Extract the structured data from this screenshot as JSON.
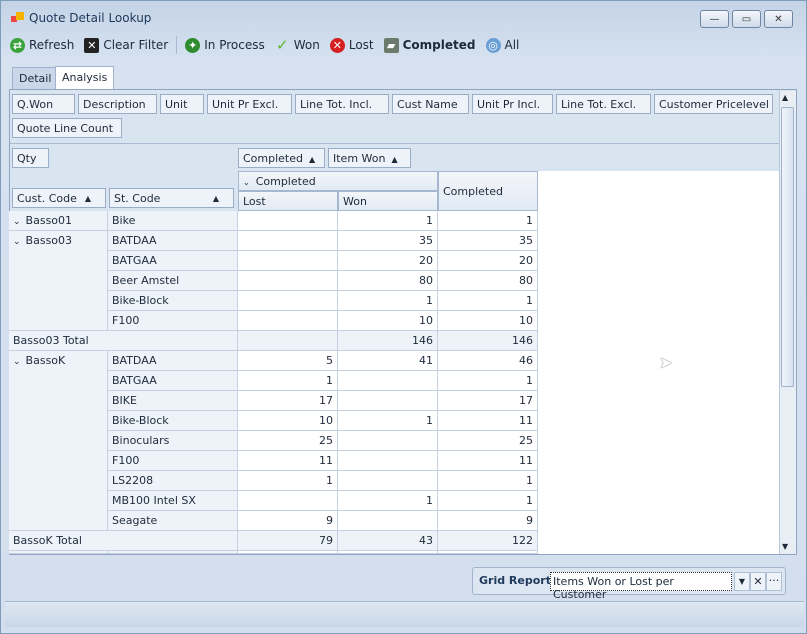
{
  "window": {
    "title": "Quote Detail Lookup",
    "buttons": [
      "minimize",
      "maximize",
      "close"
    ]
  },
  "toolbar": [
    {
      "label": "Refresh",
      "icon": "refresh-icon",
      "color": "#3aa23a"
    },
    {
      "label": "Clear Filter",
      "icon": "clear-filter-icon",
      "color": "#222222"
    },
    {
      "label": "In Process",
      "icon": "running-man-icon",
      "color": "#2e8b2e"
    },
    {
      "label": "Won",
      "icon": "checkmark-icon",
      "color": "#5cb82e"
    },
    {
      "label": "Lost",
      "icon": "x-circle-icon",
      "color": "#d42020"
    },
    {
      "label": "Completed",
      "icon": "truck-icon",
      "color": "#6b7a6b",
      "bold": true
    },
    {
      "label": "All",
      "icon": "globe-icon",
      "color": "#6a9fd4"
    }
  ],
  "tabs": [
    {
      "label": "Detail"
    },
    {
      "label": "Analysis",
      "active": true
    }
  ],
  "filter_fields": [
    "Q.Won",
    "Description",
    "Unit",
    "Unit Pr Excl.",
    "Line Tot. Incl.",
    "Cust Name",
    "Unit Pr Incl.",
    "Line Tot. Excl.",
    "Customer Pricelevel",
    "Quote Line Count"
  ],
  "data_field": "Qty",
  "column_fields": [
    "Completed",
    "Item Won"
  ],
  "row_fields": [
    "Cust. Code",
    "St. Code"
  ],
  "col_group": "Completed",
  "col_headers": [
    "Lost",
    "Won"
  ],
  "grand_header": "Completed",
  "rows": [
    {
      "cust": "Basso01",
      "st": "Bike",
      "lost": "",
      "won": "1",
      "total": "1"
    },
    {
      "cust": "Basso03",
      "st": "BATDAA",
      "lost": "",
      "won": "35",
      "total": "35"
    },
    {
      "cust": "",
      "st": "BATGAA",
      "lost": "",
      "won": "20",
      "total": "20"
    },
    {
      "cust": "",
      "st": "Beer Amstel",
      "lost": "",
      "won": "80",
      "total": "80"
    },
    {
      "cust": "",
      "st": "Bike-Block",
      "lost": "",
      "won": "1",
      "total": "1"
    },
    {
      "cust": "",
      "st": "F100",
      "lost": "",
      "won": "10",
      "total": "10"
    },
    {
      "subtotal": "Basso03 Total",
      "lost": "",
      "won": "146",
      "total": "146"
    },
    {
      "cust": "BassoK",
      "st": "BATDAA",
      "lost": "5",
      "won": "41",
      "total": "46"
    },
    {
      "cust": "",
      "st": "BATGAA",
      "lost": "1",
      "won": "",
      "total": "1"
    },
    {
      "cust": "",
      "st": "BIKE",
      "lost": "17",
      "won": "",
      "total": "17"
    },
    {
      "cust": "",
      "st": "Bike-Block",
      "lost": "10",
      "won": "1",
      "total": "11"
    },
    {
      "cust": "",
      "st": "Binoculars",
      "lost": "25",
      "won": "",
      "total": "25"
    },
    {
      "cust": "",
      "st": "F100",
      "lost": "11",
      "won": "",
      "total": "11"
    },
    {
      "cust": "",
      "st": "LS2208",
      "lost": "1",
      "won": "",
      "total": "1"
    },
    {
      "cust": "",
      "st": "MB100 Intel SX",
      "lost": "",
      "won": "1",
      "total": "1"
    },
    {
      "cust": "",
      "st": "Seagate",
      "lost": "9",
      "won": "",
      "total": "9"
    },
    {
      "subtotal": "BassoK Total",
      "lost": "79",
      "won": "43",
      "total": "122"
    }
  ],
  "grid_report": {
    "label": "Grid Report:",
    "value": "Items Won or Lost per Customer"
  }
}
